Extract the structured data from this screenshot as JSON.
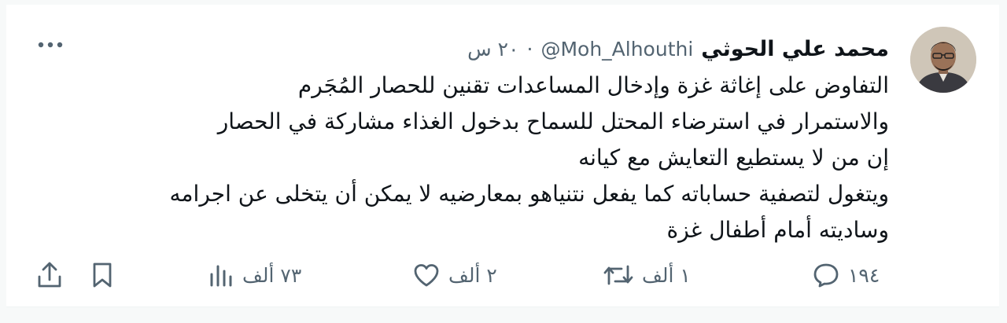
{
  "tweet": {
    "author": {
      "display_name": "محمد علي الحوثي",
      "handle": "@Moh_Alhouthi",
      "separator": "·",
      "time": "٢٠ س"
    },
    "text_lines": [
      "التفاوض على إغاثة غزة وإدخال المساعدات تقنين للحصار المُجَرم",
      "والاستمرار في استرضاء المحتل للسماح بدخول الغذاء مشاركة في الحصار",
      "إن من لا يستطيع التعايش مع كيانه",
      "ويتغول لتصفية حساباته كما يفعل نتنياهو بمعارضيه لا يمكن أن يتخلى عن اجرامه",
      "وساديته أمام أطفال غزة"
    ],
    "actions": {
      "replies": "١٩٤",
      "reposts": "١ ألف",
      "likes": "٢ ألف",
      "views": "٧٣ ألف"
    },
    "icons": {
      "more": "more-horizontal-icon",
      "reply": "reply-bubble-icon",
      "repost": "repost-arrows-icon",
      "like": "heart-icon",
      "views": "views-bar-chart-icon",
      "bookmark": "bookmark-icon",
      "share": "share-upload-icon"
    },
    "colors": {
      "text": "#0f1419",
      "secondary": "#536471",
      "border": "#eff3f4"
    }
  }
}
